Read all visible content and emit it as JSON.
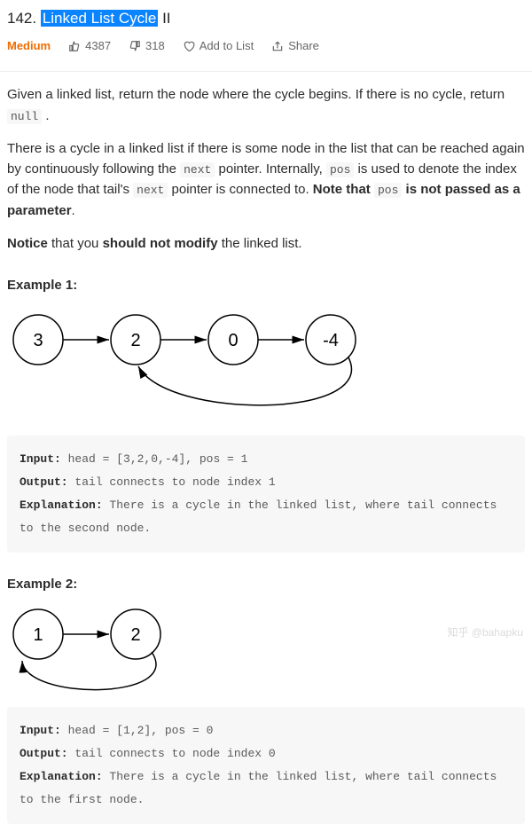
{
  "title": {
    "number": "142.",
    "highlighted": "Linked List Cycle",
    "suffix": " II"
  },
  "meta": {
    "difficulty": "Medium",
    "likes": "4387",
    "dislikes": "318",
    "add_label": "Add to List",
    "share_label": "Share"
  },
  "description": {
    "p1_prefix": "Given a linked list, return the node where the cycle begins. If there is no cycle, return ",
    "p1_code": "null",
    "p1_suffix": " .",
    "p2_a": "There is a cycle in a linked list if there is some node in the list that can be reached again by continuously following the ",
    "p2_code1": "next",
    "p2_b": " pointer. Internally, ",
    "p2_code2": "pos",
    "p2_c": " is used to denote the index of the node that tail's ",
    "p2_code3": "next",
    "p2_d": " pointer is connected to. ",
    "p2_bold1": "Note that ",
    "p2_code4": "pos",
    "p2_bold2": " is not passed as a parameter",
    "p2_end": ".",
    "p3_a": "Notice",
    "p3_b": " that you ",
    "p3_c": "should not modify",
    "p3_d": " the linked list."
  },
  "example1": {
    "heading": "Example 1:",
    "nodes": [
      "3",
      "2",
      "0",
      "-4"
    ],
    "input_label": "Input:",
    "input_val": " head = [3,2,0,-4], pos = 1",
    "output_label": "Output:",
    "output_val": " tail connects to node index 1",
    "explain_label": "Explanation:",
    "explain_val": " There is a cycle in the linked list, where tail connects to the second node."
  },
  "example2": {
    "heading": "Example 2:",
    "nodes": [
      "1",
      "2"
    ],
    "input_label": "Input:",
    "input_val": " head = [1,2], pos = 0",
    "output_label": "Output:",
    "output_val": " tail connects to node index 0",
    "explain_label": "Explanation:",
    "explain_val": " There is a cycle in the linked list, where tail connects to the first node."
  },
  "watermark": "知乎 @bahapku"
}
